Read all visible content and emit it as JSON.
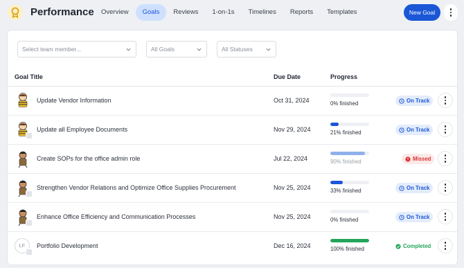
{
  "header": {
    "title": "Performance",
    "logo_icon": "award-badge-icon",
    "tabs": [
      {
        "label": "Overview",
        "active": false
      },
      {
        "label": "Goals",
        "active": true
      },
      {
        "label": "Reviews",
        "active": false
      },
      {
        "label": "1-on-1s",
        "active": false
      },
      {
        "label": "Timelines",
        "active": false
      },
      {
        "label": "Reports",
        "active": false
      },
      {
        "label": "Templates",
        "active": false
      }
    ],
    "new_goal_label": "New Goal"
  },
  "filters": {
    "team_member_placeholder": "Select team member...",
    "goals_value": "All Goals",
    "statuses_value": "All Statuses"
  },
  "table": {
    "columns": [
      "Goal Title",
      "Due Date",
      "Progress"
    ],
    "rows": [
      {
        "title": "Update Vendor Information",
        "due": "Oct 31, 2024",
        "progress": 0,
        "progress_label": "0% finished",
        "status": "On Track"
      },
      {
        "title": "Update all Employee Documents",
        "due": "Nov 29, 2024",
        "progress": 21,
        "progress_label": "21% finished",
        "status": "On Track"
      },
      {
        "title": "Create SOPs for the office admin role",
        "due": "Jul 22, 2024",
        "progress": 90,
        "progress_label": "90% finished",
        "status": "Missed"
      },
      {
        "title": "Strengthen Vendor Relations and Optimize Office Supplies Procurement",
        "due": "Nov 25, 2024",
        "progress": 33,
        "progress_label": "33% finished",
        "status": "On Track"
      },
      {
        "title": "Enhance Office Efficiency and Communication Processes",
        "due": "Nov 25, 2024",
        "progress": 0,
        "progress_label": "0% finished",
        "status": "On Track"
      },
      {
        "title": "Portfolio Development",
        "due": "Dec 16, 2024",
        "progress": 100,
        "progress_label": "100% finished",
        "status": "Completed",
        "avatar_initials": "LF"
      }
    ]
  },
  "colors": {
    "accent": "#1a56d6",
    "on_track": "#1a56d6",
    "missed": "#d63434",
    "missed_bar": "#8fb0ea",
    "completed": "#22a55a"
  }
}
